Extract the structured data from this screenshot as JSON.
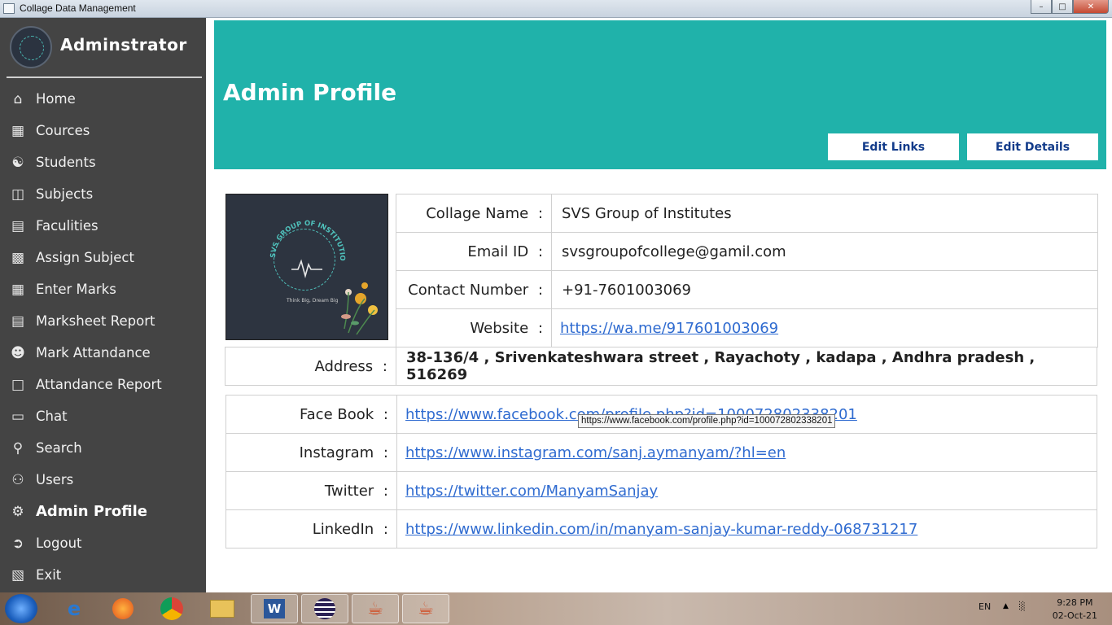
{
  "window": {
    "title": "Collage Data Management"
  },
  "sidebar": {
    "user_name": "Adminstrator",
    "items": [
      {
        "label": "Home",
        "icon": "home-icon"
      },
      {
        "label": "Cources",
        "icon": "books-icon"
      },
      {
        "label": "Students",
        "icon": "students-icon"
      },
      {
        "label": "Subjects",
        "icon": "open-book-icon"
      },
      {
        "label": "Faculities",
        "icon": "id-card-icon"
      },
      {
        "label": "Assign Subject",
        "icon": "assign-icon"
      },
      {
        "label": "Enter Marks",
        "icon": "marks-icon"
      },
      {
        "label": "Marksheet Report",
        "icon": "report-icon"
      },
      {
        "label": "Mark Attandance",
        "icon": "attendance-icon"
      },
      {
        "label": "Attandance Report",
        "icon": "document-icon"
      },
      {
        "label": "Chat",
        "icon": "chat-icon"
      },
      {
        "label": "Search",
        "icon": "search-user-icon"
      },
      {
        "label": "Users",
        "icon": "users-icon"
      },
      {
        "label": "Admin Profile",
        "icon": "user-gear-icon",
        "active": true
      },
      {
        "label": "Logout",
        "icon": "logout-icon"
      },
      {
        "label": "Exit",
        "icon": "exit-icon"
      }
    ]
  },
  "header": {
    "title": "Admin Profile",
    "edit_links_label": "Edit Links",
    "edit_details_label": "Edit Details",
    "bg_color": "#20b2aa"
  },
  "logo": {
    "text_arc": "SVS GROUP OF INSTITUTIONS",
    "tagline": "Think Big, Dream Big"
  },
  "details": {
    "college_name_label": "Collage Name",
    "college_name": "SVS Group of Institutes",
    "email_label": "Email ID",
    "email": "svsgroupofcollege@gamil.com",
    "contact_label": "Contact Number",
    "contact": "+91-7601003069",
    "website_label": "Website",
    "website": "https://wa.me/917601003069",
    "address_label": "Address",
    "address": "38-136/4 , Srivenkateshwara street , Rayachoty , kadapa  , Andhra pradesh , 516269"
  },
  "links": {
    "facebook_label": "Face Book",
    "facebook": "https://www.facebook.com/profile.php?id=100072802338201",
    "instagram_label": "Instagram",
    "instagram": "https://www.instagram.com/sanj.aymanyam/?hl=en",
    "twitter_label": "Twitter",
    "twitter": "https://twitter.com/ManyamSanjay",
    "linkedin_label": "LinkedIn",
    "linkedin": "https://www.linkedin.com/in/manyam-sanjay-kumar-reddy-068731217"
  },
  "separator": ":",
  "tooltip": "https://www.facebook.com/profile.php?id=100072802338201",
  "taskbar": {
    "lang": "EN",
    "time": "9:28 PM",
    "date": "02-Oct-21"
  }
}
